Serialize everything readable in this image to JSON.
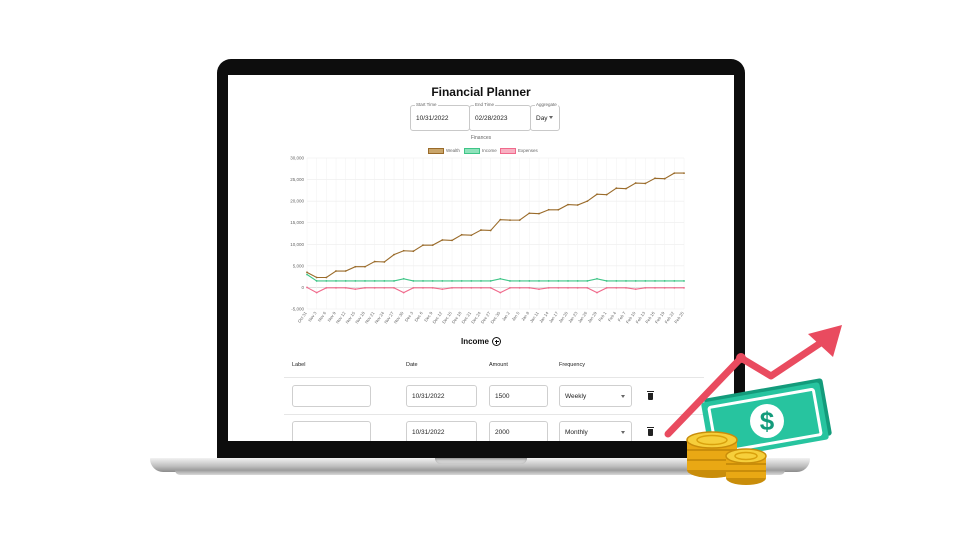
{
  "app": {
    "title": "Financial Planner"
  },
  "controls": {
    "start": {
      "label": "Start Time",
      "value": "10/31/2022"
    },
    "end": {
      "label": "End Time",
      "value": "02/28/2023"
    },
    "aggregate": {
      "label": "Aggregate",
      "value": "Day"
    }
  },
  "colors": {
    "wealth": "#9a6b2a",
    "income": "#3fc587",
    "expenses": "#f06a8c",
    "arrow": "#e94b5f",
    "bill": "#1fae8c",
    "coin": "#f2c12e"
  },
  "chart_data": {
    "type": "line",
    "title": "Finances",
    "legend": [
      "Wealth",
      "Income",
      "Expenses"
    ],
    "legend_position": "top",
    "grid": true,
    "ylim": [
      -5000,
      30000
    ],
    "y_ticks": [
      "30,000",
      "25,000",
      "20,000",
      "15,000",
      "10,000",
      "5,000",
      "0",
      "-5,000"
    ],
    "categories": [
      "Oct 31",
      "Nov 3",
      "Nov 6",
      "Nov 9",
      "Nov 12",
      "Nov 15",
      "Nov 18",
      "Nov 21",
      "Nov 24",
      "Nov 27",
      "Nov 30",
      "Dec 3",
      "Dec 6",
      "Dec 9",
      "Dec 12",
      "Dec 15",
      "Dec 18",
      "Dec 21",
      "Dec 24",
      "Dec 27",
      "Dec 30",
      "Jan 2",
      "Jan 5",
      "Jan 8",
      "Jan 11",
      "Jan 14",
      "Jan 17",
      "Jan 20",
      "Jan 23",
      "Jan 26",
      "Jan 29",
      "Feb 1",
      "Feb 4",
      "Feb 7",
      "Feb 10",
      "Feb 13",
      "Feb 16",
      "Feb 19",
      "Feb 22",
      "Feb 25"
    ],
    "series": [
      {
        "name": "Wealth",
        "values": [
          3500,
          2300,
          2300,
          3800,
          3800,
          4800,
          4800,
          6000,
          5900,
          7600,
          8500,
          8400,
          9800,
          9800,
          11000,
          10900,
          12200,
          12100,
          13300,
          13200,
          15700,
          15600,
          15600,
          17200,
          17100,
          18000,
          18000,
          19200,
          19100,
          20000,
          21600,
          21500,
          23000,
          22900,
          24200,
          24100,
          25300,
          25200,
          26500,
          26500
        ]
      },
      {
        "name": "Income",
        "values": [
          3000,
          1500,
          1500,
          1500,
          1500,
          1500,
          1500,
          1500,
          1500,
          1500,
          2000,
          1500,
          1500,
          1500,
          1500,
          1500,
          1500,
          1500,
          1500,
          1500,
          2000,
          1500,
          1500,
          1500,
          1500,
          1500,
          1500,
          1500,
          1500,
          1500,
          2000,
          1500,
          1500,
          1500,
          1500,
          1500,
          1500,
          1500,
          1500,
          1500
        ]
      },
      {
        "name": "Expenses",
        "values": [
          0,
          -1200,
          -100,
          -100,
          -100,
          -400,
          -100,
          -100,
          -100,
          -100,
          -1200,
          -100,
          -100,
          -100,
          -400,
          -100,
          -100,
          -100,
          -100,
          -100,
          -1200,
          -100,
          -100,
          -100,
          -400,
          -100,
          -100,
          -100,
          -100,
          -100,
          -1200,
          -100,
          -100,
          -100,
          -400,
          -100,
          -100,
          -100,
          -100,
          -100
        ]
      }
    ]
  },
  "income": {
    "heading": "Income",
    "columns": [
      "Label",
      "Date",
      "Amount",
      "Frequency"
    ],
    "rows": [
      {
        "label": "",
        "date": "10/31/2022",
        "amount": "1500",
        "frequency": "Weekly"
      },
      {
        "label": "",
        "date": "10/31/2022",
        "amount": "2000",
        "frequency": "Monthly"
      }
    ]
  }
}
